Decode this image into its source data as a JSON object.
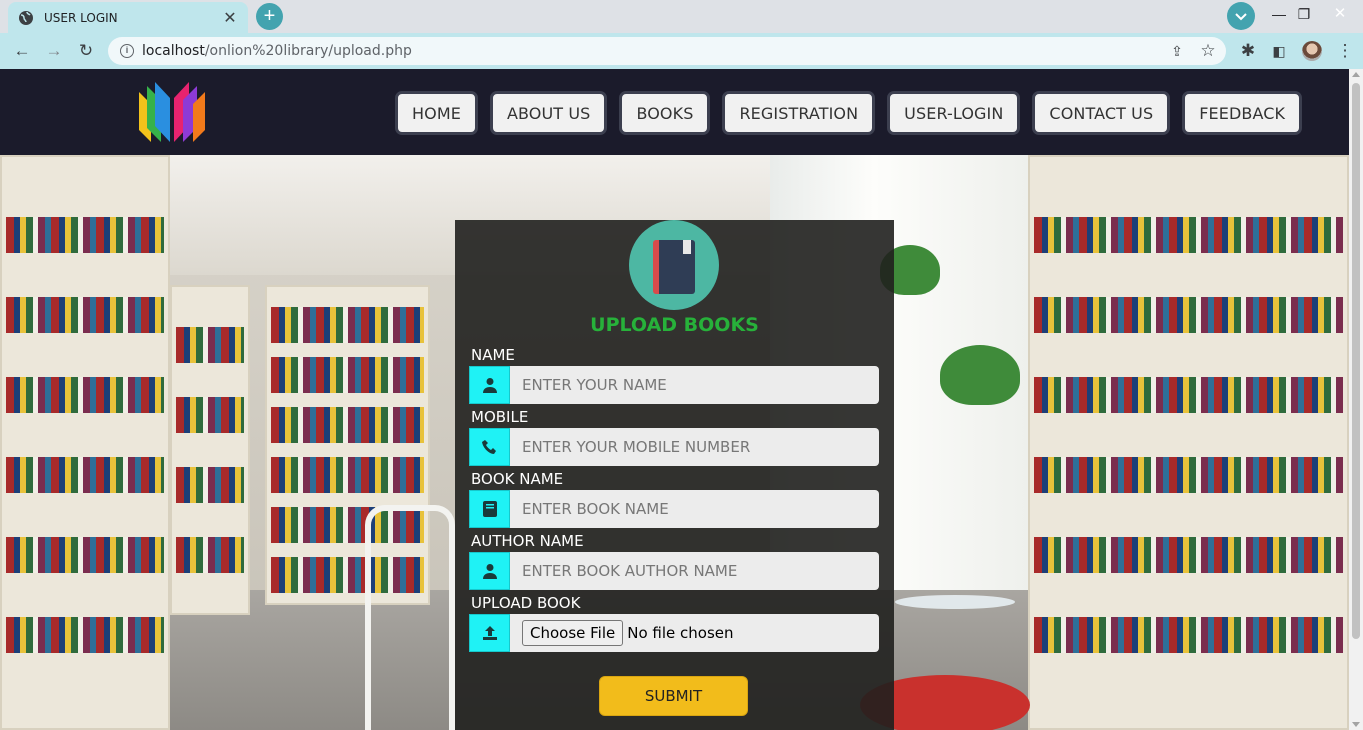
{
  "browser": {
    "tab_title": "USER LOGIN",
    "url_host": "localhost",
    "url_path": "/onlion%20library/upload.php"
  },
  "nav": {
    "items": [
      "HOME",
      "ABOUT US",
      "BOOKS",
      "REGISTRATION",
      "USER-LOGIN",
      "CONTACT US",
      "FEEDBACK"
    ]
  },
  "form": {
    "title": "UPLOAD BOOKS",
    "name_label": "NAME",
    "name_placeholder": "ENTER YOUR NAME",
    "mobile_label": "MOBILE",
    "mobile_placeholder": "ENTER YOUR MOBILE NUMBER",
    "book_label": "BOOK NAME",
    "book_placeholder": "ENTER BOOK NAME",
    "author_label": "AUTHOR NAME",
    "author_placeholder": "ENTER BOOK AUTHOR NAME",
    "upload_label": "UPLOAD BOOK",
    "choose_file": "Choose File",
    "no_file": "No file chosen",
    "submit": "SUBMIT"
  },
  "colors": {
    "navbar": "#1b1b2b",
    "title_green": "#27b13a",
    "icon_cyan": "#1ff2f5",
    "submit_yellow": "#f2bc1b"
  },
  "icons": {
    "name": "user-icon",
    "mobile": "phone-icon",
    "book": "book-icon",
    "author": "user-icon",
    "upload": "upload-icon"
  }
}
